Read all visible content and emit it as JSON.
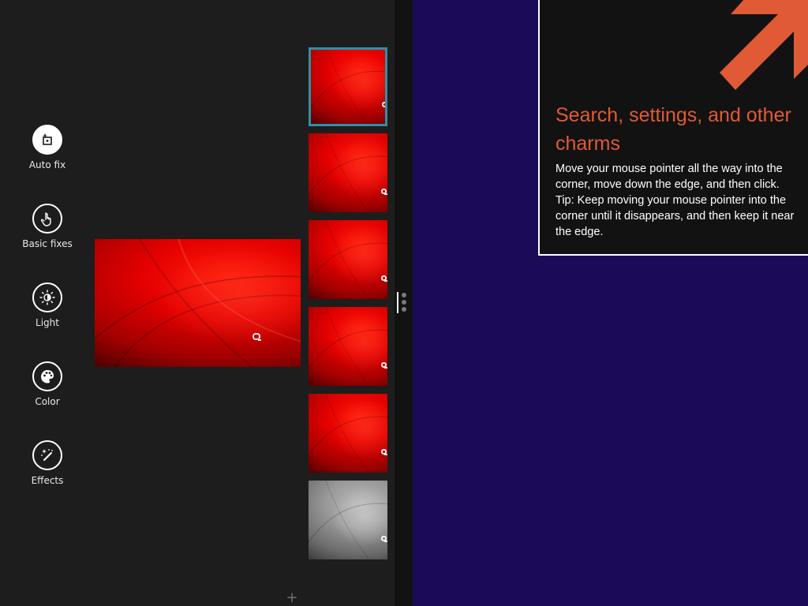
{
  "tools": [
    {
      "label": "Auto fix",
      "icon": "auto-fix-icon",
      "active": true
    },
    {
      "label": "Basic fixes",
      "icon": "hand-touch-icon",
      "active": false
    },
    {
      "label": "Light",
      "icon": "sun-icon",
      "active": false
    },
    {
      "label": "Color",
      "icon": "palette-icon",
      "active": false
    },
    {
      "label": "Effects",
      "icon": "magic-wand-icon",
      "active": false
    }
  ],
  "thumbnails": [
    {
      "style": "red",
      "selected": true
    },
    {
      "style": "red",
      "selected": false
    },
    {
      "style": "red",
      "selected": false
    },
    {
      "style": "red",
      "selected": false
    },
    {
      "style": "red",
      "selected": false
    },
    {
      "style": "grayscale",
      "selected": false
    }
  ],
  "add_button": {
    "icon": "plus-icon",
    "label": "+"
  },
  "charms_tip": {
    "title": "Search, settings, and other charms",
    "body": "Move your mouse pointer all the way into the corner, move down the edge, and then click. Tip: Keep moving your mouse pointer into the corner until it disappears, and then keep it near the edge.",
    "arrow_icon": "corner-arrow-icon"
  },
  "colors": {
    "app_background": "#1d1d1d",
    "start_background": "#1b0a57",
    "accent_orange": "#e05a36",
    "selection_border": "#2d91a6",
    "tip_background": "#121212"
  }
}
